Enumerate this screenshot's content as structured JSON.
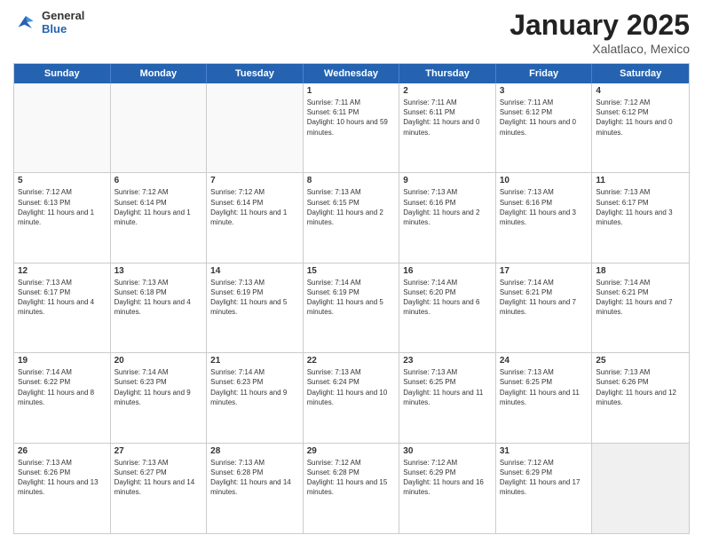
{
  "logo": {
    "general": "General",
    "blue": "Blue"
  },
  "header": {
    "month_year": "January 2025",
    "location": "Xalatlaco, Mexico"
  },
  "weekdays": [
    "Sunday",
    "Monday",
    "Tuesday",
    "Wednesday",
    "Thursday",
    "Friday",
    "Saturday"
  ],
  "rows": [
    [
      {
        "day": "",
        "empty": true
      },
      {
        "day": "",
        "empty": true
      },
      {
        "day": "",
        "empty": true
      },
      {
        "day": "1",
        "sunrise": "Sunrise: 7:11 AM",
        "sunset": "Sunset: 6:11 PM",
        "daylight": "Daylight: 10 hours and 59 minutes."
      },
      {
        "day": "2",
        "sunrise": "Sunrise: 7:11 AM",
        "sunset": "Sunset: 6:11 PM",
        "daylight": "Daylight: 11 hours and 0 minutes."
      },
      {
        "day": "3",
        "sunrise": "Sunrise: 7:11 AM",
        "sunset": "Sunset: 6:12 PM",
        "daylight": "Daylight: 11 hours and 0 minutes."
      },
      {
        "day": "4",
        "sunrise": "Sunrise: 7:12 AM",
        "sunset": "Sunset: 6:12 PM",
        "daylight": "Daylight: 11 hours and 0 minutes."
      }
    ],
    [
      {
        "day": "5",
        "sunrise": "Sunrise: 7:12 AM",
        "sunset": "Sunset: 6:13 PM",
        "daylight": "Daylight: 11 hours and 1 minute."
      },
      {
        "day": "6",
        "sunrise": "Sunrise: 7:12 AM",
        "sunset": "Sunset: 6:14 PM",
        "daylight": "Daylight: 11 hours and 1 minute."
      },
      {
        "day": "7",
        "sunrise": "Sunrise: 7:12 AM",
        "sunset": "Sunset: 6:14 PM",
        "daylight": "Daylight: 11 hours and 1 minute."
      },
      {
        "day": "8",
        "sunrise": "Sunrise: 7:13 AM",
        "sunset": "Sunset: 6:15 PM",
        "daylight": "Daylight: 11 hours and 2 minutes."
      },
      {
        "day": "9",
        "sunrise": "Sunrise: 7:13 AM",
        "sunset": "Sunset: 6:16 PM",
        "daylight": "Daylight: 11 hours and 2 minutes."
      },
      {
        "day": "10",
        "sunrise": "Sunrise: 7:13 AM",
        "sunset": "Sunset: 6:16 PM",
        "daylight": "Daylight: 11 hours and 3 minutes."
      },
      {
        "day": "11",
        "sunrise": "Sunrise: 7:13 AM",
        "sunset": "Sunset: 6:17 PM",
        "daylight": "Daylight: 11 hours and 3 minutes."
      }
    ],
    [
      {
        "day": "12",
        "sunrise": "Sunrise: 7:13 AM",
        "sunset": "Sunset: 6:17 PM",
        "daylight": "Daylight: 11 hours and 4 minutes."
      },
      {
        "day": "13",
        "sunrise": "Sunrise: 7:13 AM",
        "sunset": "Sunset: 6:18 PM",
        "daylight": "Daylight: 11 hours and 4 minutes."
      },
      {
        "day": "14",
        "sunrise": "Sunrise: 7:13 AM",
        "sunset": "Sunset: 6:19 PM",
        "daylight": "Daylight: 11 hours and 5 minutes."
      },
      {
        "day": "15",
        "sunrise": "Sunrise: 7:14 AM",
        "sunset": "Sunset: 6:19 PM",
        "daylight": "Daylight: 11 hours and 5 minutes."
      },
      {
        "day": "16",
        "sunrise": "Sunrise: 7:14 AM",
        "sunset": "Sunset: 6:20 PM",
        "daylight": "Daylight: 11 hours and 6 minutes."
      },
      {
        "day": "17",
        "sunrise": "Sunrise: 7:14 AM",
        "sunset": "Sunset: 6:21 PM",
        "daylight": "Daylight: 11 hours and 7 minutes."
      },
      {
        "day": "18",
        "sunrise": "Sunrise: 7:14 AM",
        "sunset": "Sunset: 6:21 PM",
        "daylight": "Daylight: 11 hours and 7 minutes."
      }
    ],
    [
      {
        "day": "19",
        "sunrise": "Sunrise: 7:14 AM",
        "sunset": "Sunset: 6:22 PM",
        "daylight": "Daylight: 11 hours and 8 minutes."
      },
      {
        "day": "20",
        "sunrise": "Sunrise: 7:14 AM",
        "sunset": "Sunset: 6:23 PM",
        "daylight": "Daylight: 11 hours and 9 minutes."
      },
      {
        "day": "21",
        "sunrise": "Sunrise: 7:14 AM",
        "sunset": "Sunset: 6:23 PM",
        "daylight": "Daylight: 11 hours and 9 minutes."
      },
      {
        "day": "22",
        "sunrise": "Sunrise: 7:13 AM",
        "sunset": "Sunset: 6:24 PM",
        "daylight": "Daylight: 11 hours and 10 minutes."
      },
      {
        "day": "23",
        "sunrise": "Sunrise: 7:13 AM",
        "sunset": "Sunset: 6:25 PM",
        "daylight": "Daylight: 11 hours and 11 minutes."
      },
      {
        "day": "24",
        "sunrise": "Sunrise: 7:13 AM",
        "sunset": "Sunset: 6:25 PM",
        "daylight": "Daylight: 11 hours and 11 minutes."
      },
      {
        "day": "25",
        "sunrise": "Sunrise: 7:13 AM",
        "sunset": "Sunset: 6:26 PM",
        "daylight": "Daylight: 11 hours and 12 minutes."
      }
    ],
    [
      {
        "day": "26",
        "sunrise": "Sunrise: 7:13 AM",
        "sunset": "Sunset: 6:26 PM",
        "daylight": "Daylight: 11 hours and 13 minutes."
      },
      {
        "day": "27",
        "sunrise": "Sunrise: 7:13 AM",
        "sunset": "Sunset: 6:27 PM",
        "daylight": "Daylight: 11 hours and 14 minutes."
      },
      {
        "day": "28",
        "sunrise": "Sunrise: 7:13 AM",
        "sunset": "Sunset: 6:28 PM",
        "daylight": "Daylight: 11 hours and 14 minutes."
      },
      {
        "day": "29",
        "sunrise": "Sunrise: 7:12 AM",
        "sunset": "Sunset: 6:28 PM",
        "daylight": "Daylight: 11 hours and 15 minutes."
      },
      {
        "day": "30",
        "sunrise": "Sunrise: 7:12 AM",
        "sunset": "Sunset: 6:29 PM",
        "daylight": "Daylight: 11 hours and 16 minutes."
      },
      {
        "day": "31",
        "sunrise": "Sunrise: 7:12 AM",
        "sunset": "Sunset: 6:29 PM",
        "daylight": "Daylight: 11 hours and 17 minutes."
      },
      {
        "day": "",
        "empty": true,
        "shaded": true
      }
    ]
  ]
}
